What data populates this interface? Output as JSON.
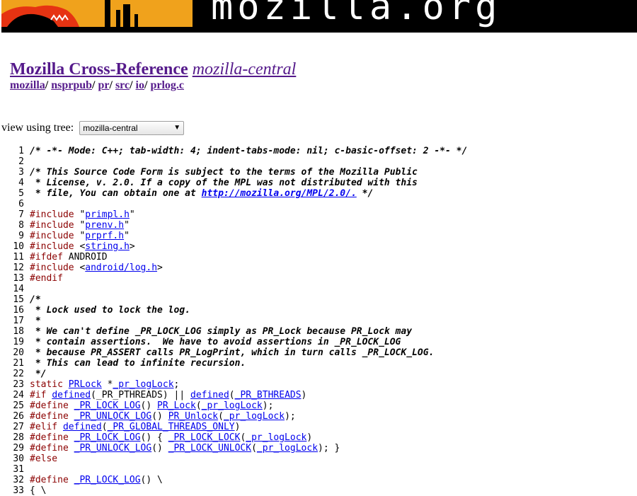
{
  "banner": {
    "site_name": "mozilla.org"
  },
  "header": {
    "project": "Mozilla Cross-Reference",
    "tree": "mozilla-central",
    "breadcrumbs": [
      "mozilla",
      "nsprpub",
      "pr",
      "src",
      "io",
      "prlog.c"
    ]
  },
  "tree_picker": {
    "label": "view using tree:",
    "selected": "mozilla-central"
  },
  "code_lines": [
    [
      {
        "t": "cm",
        "v": "/* -*- Mode: C++; tab-width: 4; indent-tabs-mode: nil; c-basic-offset: 2 -*- */"
      }
    ],
    [],
    [
      {
        "t": "cm",
        "v": "/* This Source Code Form is subject to the terms of the Mozilla Public"
      }
    ],
    [
      {
        "t": "cm",
        "v": " * License, v. 2.0. If a copy of the MPL was not distributed with this"
      }
    ],
    [
      {
        "t": "cm",
        "v": " * file, You can obtain one at "
      },
      {
        "t": "cml",
        "v": "http://mozilla.org/MPL/2.0/."
      },
      {
        "t": "cm",
        "v": " */"
      }
    ],
    [],
    [
      {
        "t": "pp",
        "v": "#include "
      },
      {
        "t": "tx",
        "v": "\""
      },
      {
        "t": "id",
        "v": "primpl.h"
      },
      {
        "t": "tx",
        "v": "\""
      }
    ],
    [
      {
        "t": "pp",
        "v": "#include "
      },
      {
        "t": "tx",
        "v": "\""
      },
      {
        "t": "id",
        "v": "prenv.h"
      },
      {
        "t": "tx",
        "v": "\""
      }
    ],
    [
      {
        "t": "pp",
        "v": "#include "
      },
      {
        "t": "tx",
        "v": "\""
      },
      {
        "t": "id",
        "v": "prprf.h"
      },
      {
        "t": "tx",
        "v": "\""
      }
    ],
    [
      {
        "t": "pp",
        "v": "#include "
      },
      {
        "t": "tx",
        "v": "<"
      },
      {
        "t": "id",
        "v": "string.h"
      },
      {
        "t": "tx",
        "v": ">"
      }
    ],
    [
      {
        "t": "pp",
        "v": "#ifdef "
      },
      {
        "t": "tx",
        "v": "ANDROID"
      }
    ],
    [
      {
        "t": "pp",
        "v": "#include "
      },
      {
        "t": "tx",
        "v": "<"
      },
      {
        "t": "id",
        "v": "android/log.h"
      },
      {
        "t": "tx",
        "v": ">"
      }
    ],
    [
      {
        "t": "pp",
        "v": "#endif"
      }
    ],
    [],
    [
      {
        "t": "cm",
        "v": "/*"
      }
    ],
    [
      {
        "t": "cm",
        "v": " * Lock used to lock the log."
      }
    ],
    [
      {
        "t": "cm",
        "v": " *"
      }
    ],
    [
      {
        "t": "cm",
        "v": " * We can't define _PR_LOCK_LOG simply as PR_Lock because PR_Lock may"
      }
    ],
    [
      {
        "t": "cm",
        "v": " * contain assertions.  We have to avoid assertions in _PR_LOCK_LOG"
      }
    ],
    [
      {
        "t": "cm",
        "v": " * because PR_ASSERT calls PR_LogPrint, which in turn calls _PR_LOCK_LOG."
      }
    ],
    [
      {
        "t": "cm",
        "v": " * This can lead to infinite recursion."
      }
    ],
    [
      {
        "t": "cm",
        "v": " */"
      }
    ],
    [
      {
        "t": "kw",
        "v": "static "
      },
      {
        "t": "id",
        "v": "PRLock"
      },
      {
        "t": "tx",
        "v": " *"
      },
      {
        "t": "id",
        "v": "_pr_logLock"
      },
      {
        "t": "tx",
        "v": ";"
      }
    ],
    [
      {
        "t": "pp",
        "v": "#if "
      },
      {
        "t": "id",
        "v": "defined"
      },
      {
        "t": "tx",
        "v": "(_PR_PTHREADS) || "
      },
      {
        "t": "id",
        "v": "defined"
      },
      {
        "t": "tx",
        "v": "("
      },
      {
        "t": "id",
        "v": "_PR_BTHREADS"
      },
      {
        "t": "tx",
        "v": ")"
      }
    ],
    [
      {
        "t": "pp",
        "v": "#define "
      },
      {
        "t": "id",
        "v": "_PR_LOCK_LOG"
      },
      {
        "t": "tx",
        "v": "() "
      },
      {
        "t": "id",
        "v": "PR_Lock"
      },
      {
        "t": "tx",
        "v": "("
      },
      {
        "t": "id",
        "v": "_pr_logLock"
      },
      {
        "t": "tx",
        "v": ");"
      }
    ],
    [
      {
        "t": "pp",
        "v": "#define "
      },
      {
        "t": "id",
        "v": "_PR_UNLOCK_LOG"
      },
      {
        "t": "tx",
        "v": "() "
      },
      {
        "t": "id",
        "v": "PR_Unlock"
      },
      {
        "t": "tx",
        "v": "("
      },
      {
        "t": "id",
        "v": "_pr_logLock"
      },
      {
        "t": "tx",
        "v": ");"
      }
    ],
    [
      {
        "t": "pp",
        "v": "#elif "
      },
      {
        "t": "id",
        "v": "defined"
      },
      {
        "t": "tx",
        "v": "("
      },
      {
        "t": "id",
        "v": "_PR_GLOBAL_THREADS_ONLY"
      },
      {
        "t": "tx",
        "v": ")"
      }
    ],
    [
      {
        "t": "pp",
        "v": "#define "
      },
      {
        "t": "id",
        "v": "_PR_LOCK_LOG"
      },
      {
        "t": "tx",
        "v": "() { "
      },
      {
        "t": "id",
        "v": "_PR_LOCK_LOCK"
      },
      {
        "t": "tx",
        "v": "("
      },
      {
        "t": "id",
        "v": "_pr_logLock"
      },
      {
        "t": "tx",
        "v": ")"
      }
    ],
    [
      {
        "t": "pp",
        "v": "#define "
      },
      {
        "t": "id",
        "v": "_PR_UNLOCK_LOG"
      },
      {
        "t": "tx",
        "v": "() "
      },
      {
        "t": "id",
        "v": "_PR_LOCK_UNLOCK"
      },
      {
        "t": "tx",
        "v": "("
      },
      {
        "t": "id",
        "v": "_pr_logLock"
      },
      {
        "t": "tx",
        "v": "); }"
      }
    ],
    [
      {
        "t": "pp",
        "v": "#else"
      }
    ],
    [],
    [
      {
        "t": "pp",
        "v": "#define "
      },
      {
        "t": "id",
        "v": "_PR_LOCK_LOG"
      },
      {
        "t": "tx",
        "v": "() \\"
      }
    ],
    [
      {
        "t": "tx",
        "v": "{ \\"
      }
    ]
  ]
}
